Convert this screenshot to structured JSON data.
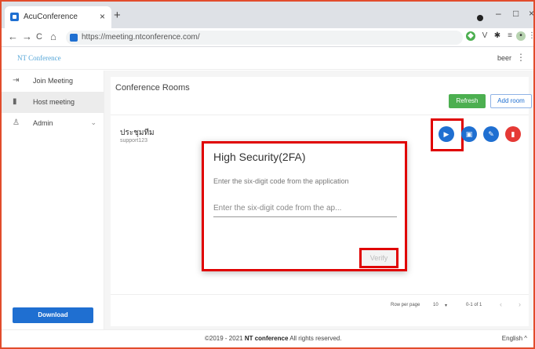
{
  "browser": {
    "tab_title": "AcuConference",
    "tab_close": "×",
    "new_tab": "+",
    "url": "https://meeting.ntconference.com/",
    "nav": {
      "back": "←",
      "forward": "→",
      "reload": "C",
      "home": "⌂"
    }
  },
  "app": {
    "brand": "NT Conference",
    "user": "beer",
    "menu": "⋮"
  },
  "sidebar": {
    "items": [
      {
        "label": "Join Meeting",
        "icon": "login-icon"
      },
      {
        "label": "Host meeting",
        "icon": "phone-icon"
      },
      {
        "label": "Admin",
        "icon": "admin-icon"
      }
    ],
    "download_label": "Download"
  },
  "main": {
    "title": "Conference Rooms",
    "refresh_label": "Refresh",
    "add_room_label": "Add room",
    "rooms": [
      {
        "name": "ประชุมทีม",
        "sub": "support123"
      }
    ],
    "pager": {
      "rows_per_page_label": "Row per page",
      "rows_per_page_value": "10",
      "range": "0-1 of 1"
    }
  },
  "modal": {
    "title": "High Security(2FA)",
    "description": "Enter the six-digit code from the application",
    "input_placeholder": "Enter the six-digit code from the ap...",
    "verify_label": "Verify"
  },
  "footer": {
    "copyright_prefix": "©2019 - 2021 ",
    "copyright_brand": "NT conference",
    "copyright_suffix": "  All rights reserved.",
    "language": "English ^"
  },
  "colors": {
    "primary": "#1f6fd1",
    "success": "#4caf50",
    "danger": "#e53935",
    "highlight": "#e00000"
  }
}
